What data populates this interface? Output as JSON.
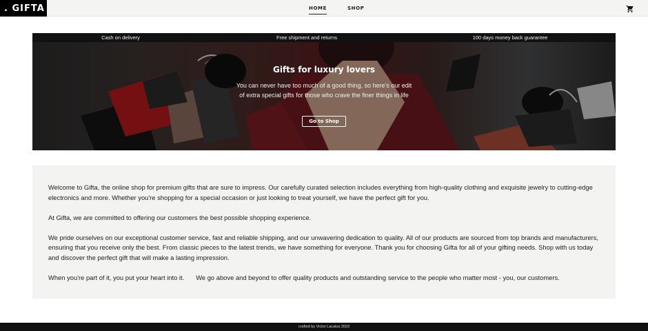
{
  "navbar": {
    "logo": ". GIFTA",
    "links": [
      {
        "label": "HOME",
        "active": true
      },
      {
        "label": "SHOP",
        "active": false
      }
    ],
    "cart_icon": "shopping-cart-icon"
  },
  "hero": {
    "promos": [
      "Cash on delivery",
      "Free shipment and returns",
      "100 days money back guarantee"
    ],
    "title": "Gifts for luxury lovers",
    "subtitle_line1": "You can never have too much of a good thing, so here's our edit",
    "subtitle_line2": "of extra special gifts for those who crave the finer things in life",
    "button": "Go to Shop"
  },
  "about": {
    "p1": "Welcome to Gifta, the online shop for premium gifts that are sure to impress. Our carefully curated selection includes everything from high-quality clothing and exquisite jewelry to cutting-edge electronics and more. Whether you're shopping for a special occasion or just looking to treat yourself, we have the perfect gift for you.",
    "p2": "At Gifta, we are committed to offering our customers the best possible shopping experience.",
    "p3": "We pride ourselves on our exceptional customer service, fast and reliable shipping, and our unwavering dedication to quality. All of our products are sourced from top brands and manufacturers, ensuring that you receive only the best. From classic pieces to the latest trends, we have something for everyone. Thank you for choosing Gifta for all of your gifting needs. Shop with us today and discover the perfect gift that will make a lasting impression.",
    "p4a": "When you're part of it, you put your heart into it.",
    "p4b": "We go above and beyond to offer quality products and outstanding service to the people who matter most - you, our customers."
  },
  "footer": {
    "credit": "crafted by Victor Lacatus 2023"
  },
  "colors": {
    "navbar_bg": "#f4f4f2",
    "logo_bg": "#000000",
    "about_bg": "#f3f3f1",
    "footer_bg": "#111111"
  }
}
